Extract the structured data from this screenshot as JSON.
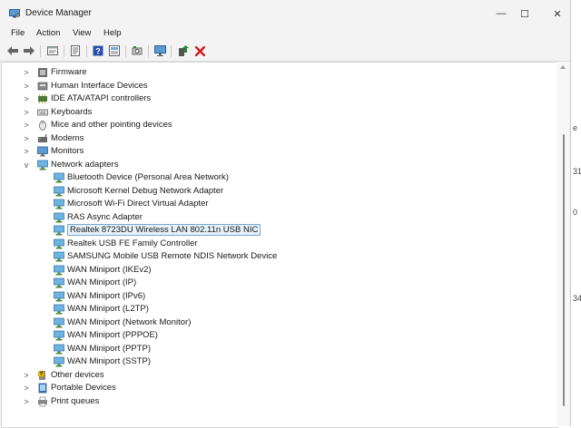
{
  "window": {
    "title": "Device Manager",
    "minimize_glyph": "—",
    "maximize_glyph": "☐",
    "close_glyph": "✕"
  },
  "menu": [
    "File",
    "Action",
    "View",
    "Help"
  ],
  "toolbar": {
    "icons": [
      "back-icon",
      "forward-icon",
      "properties-sheet-icon",
      "show-hidden-icon",
      "help-icon",
      "list-view-icon",
      "scan-hardware-icon",
      "monitor-icon",
      "update-driver-icon",
      "uninstall-icon"
    ],
    "colors": {
      "uninstall": "#d11a1a",
      "update": "#1f8b2e",
      "help": "#2a4fa8"
    }
  },
  "tree": {
    "rows": [
      {
        "label": "Firmware",
        "level": 0,
        "expander": ">",
        "icon": "firmware-icon"
      },
      {
        "label": "Human Interface Devices",
        "level": 0,
        "expander": ">",
        "icon": "hid-icon"
      },
      {
        "label": "IDE ATA/ATAPI controllers",
        "level": 0,
        "expander": ">",
        "icon": "ide-controller-icon"
      },
      {
        "label": "Keyboards",
        "level": 0,
        "expander": ">",
        "icon": "keyboard-icon"
      },
      {
        "label": "Mice and other pointing devices",
        "level": 0,
        "expander": ">",
        "icon": "mouse-icon"
      },
      {
        "label": "Modems",
        "level": 0,
        "expander": ">",
        "icon": "modem-icon"
      },
      {
        "label": "Monitors",
        "level": 0,
        "expander": ">",
        "icon": "monitor-icon"
      },
      {
        "label": "Network adapters",
        "level": 0,
        "expander": "v",
        "icon": "network-adapter-icon"
      },
      {
        "label": "Bluetooth Device (Personal Area Network)",
        "level": 1,
        "icon": "network-adapter-icon"
      },
      {
        "label": "Microsoft Kernel Debug Network Adapter",
        "level": 1,
        "icon": "network-adapter-icon"
      },
      {
        "label": "Microsoft Wi-Fi Direct Virtual Adapter",
        "level": 1,
        "icon": "network-adapter-icon"
      },
      {
        "label": "RAS Async Adapter",
        "level": 1,
        "icon": "network-adapter-icon"
      },
      {
        "label": "Realtek 8723DU Wireless LAN 802.11n USB NIC",
        "level": 1,
        "icon": "network-adapter-icon",
        "selected": true
      },
      {
        "label": "Realtek USB FE Family Controller",
        "level": 1,
        "icon": "network-adapter-icon"
      },
      {
        "label": "SAMSUNG Mobile USB Remote NDIS Network Device",
        "level": 1,
        "icon": "network-adapter-icon"
      },
      {
        "label": "WAN Miniport (IKEv2)",
        "level": 1,
        "icon": "network-adapter-icon"
      },
      {
        "label": "WAN Miniport (IP)",
        "level": 1,
        "icon": "network-adapter-icon"
      },
      {
        "label": "WAN Miniport (IPv6)",
        "level": 1,
        "icon": "network-adapter-icon"
      },
      {
        "label": "WAN Miniport (L2TP)",
        "level": 1,
        "icon": "network-adapter-icon"
      },
      {
        "label": "WAN Miniport (Network Monitor)",
        "level": 1,
        "icon": "network-adapter-icon"
      },
      {
        "label": "WAN Miniport (PPPOE)",
        "level": 1,
        "icon": "network-adapter-icon"
      },
      {
        "label": "WAN Miniport (PPTP)",
        "level": 1,
        "icon": "network-adapter-icon"
      },
      {
        "label": "WAN Miniport (SSTP)",
        "level": 1,
        "icon": "network-adapter-icon"
      },
      {
        "label": "Other devices",
        "level": 0,
        "expander": ">",
        "icon": "unknown-device-icon"
      },
      {
        "label": "Portable Devices",
        "level": 0,
        "expander": ">",
        "icon": "portable-device-icon"
      },
      {
        "label": "Print queues",
        "level": 0,
        "expander": ">",
        "icon": "printer-icon"
      }
    ]
  },
  "background_fragments": [
    "e",
    "31",
    "0",
    "34"
  ]
}
